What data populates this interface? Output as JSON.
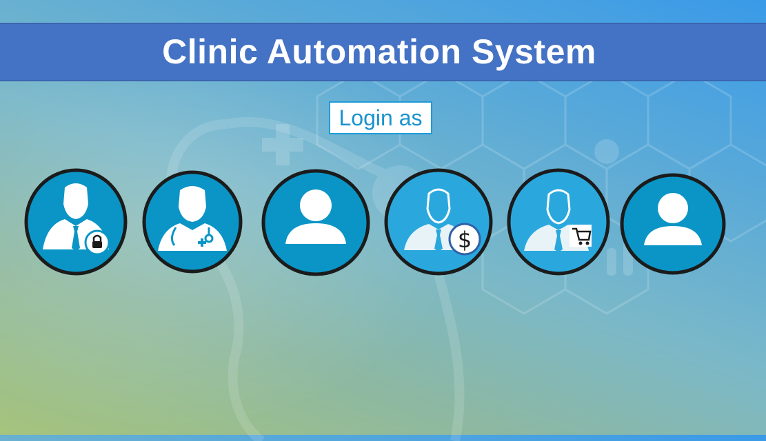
{
  "app": {
    "title": "Clinic Automation System",
    "login_label": "Login as"
  },
  "colors": {
    "title_bar": "#4472c4",
    "circle_fill": "#0a95c6",
    "circle_fill_light": "#2aa8dd",
    "circle_border": "#1b1b1b",
    "login_border": "#1f9cd6",
    "login_text": "#1993cf"
  },
  "roles": [
    {
      "icon": "admin-lock-icon"
    },
    {
      "icon": "doctor-stethoscope-icon"
    },
    {
      "icon": "user-icon"
    },
    {
      "icon": "businessman-dollar-icon"
    },
    {
      "icon": "businessman-cart-icon"
    },
    {
      "icon": "user-icon"
    }
  ]
}
